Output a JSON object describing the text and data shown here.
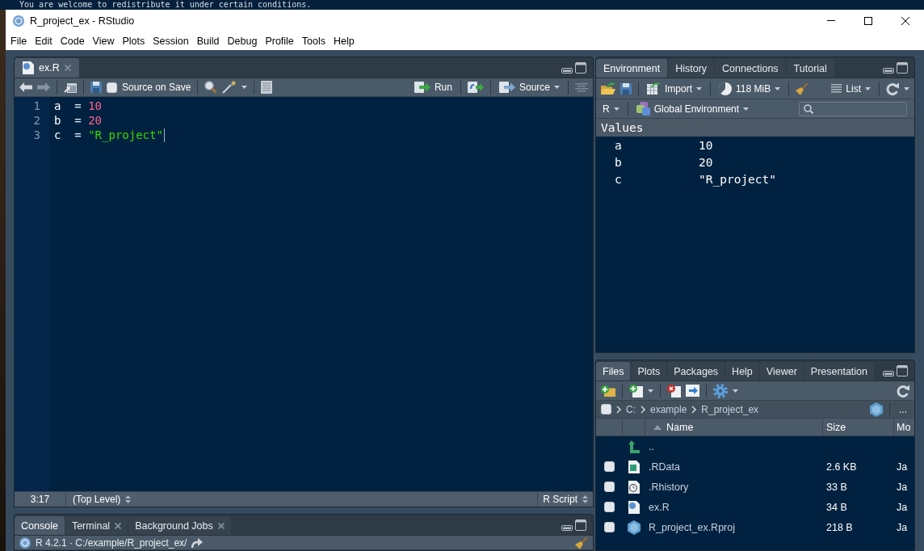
{
  "background_console_text": "You are welcome to redistribute it under certain conditions.",
  "window": {
    "title": "R_project_ex - RStudio"
  },
  "menu": [
    "File",
    "Edit",
    "Code",
    "View",
    "Plots",
    "Session",
    "Build",
    "Debug",
    "Profile",
    "Tools",
    "Help"
  ],
  "editor": {
    "tabs": [
      {
        "label": "ex.R",
        "selected": true,
        "closable": true
      }
    ],
    "toolbar": {
      "source_on_save": {
        "label": "Source on Save",
        "checked": false
      },
      "run": "Run",
      "source": "Source"
    },
    "lines": [
      {
        "number": "1",
        "cursor": false,
        "tokens": [
          {
            "kind": "identifier",
            "text": "a"
          },
          {
            "kind": "operator",
            "text": "  ="
          },
          {
            "kind": "number",
            "text": " 10"
          }
        ]
      },
      {
        "number": "2",
        "cursor": false,
        "tokens": [
          {
            "kind": "identifier",
            "text": "b"
          },
          {
            "kind": "operator",
            "text": "  ="
          },
          {
            "kind": "number",
            "text": " 20"
          }
        ]
      },
      {
        "number": "3",
        "cursor": true,
        "tokens": [
          {
            "kind": "identifier",
            "text": "c"
          },
          {
            "kind": "operator",
            "text": "  ="
          },
          {
            "kind": "string",
            "text": " \"R_project\""
          }
        ]
      }
    ],
    "status": {
      "position": "3:17",
      "scope": "(Top Level)",
      "file_type": "R Script"
    }
  },
  "console": {
    "tabs": [
      {
        "label": "Console",
        "selected": true,
        "closable": false
      },
      {
        "label": "Terminal",
        "selected": false,
        "closable": true
      },
      {
        "label": "Background Jobs",
        "selected": false,
        "closable": true
      }
    ],
    "path": "R 4.2.1 · C:/example/R_project_ex/"
  },
  "environment": {
    "tabs": [
      {
        "label": "Environment",
        "selected": true
      },
      {
        "label": "History",
        "selected": false
      },
      {
        "label": "Connections",
        "selected": false
      },
      {
        "label": "Tutorial",
        "selected": false
      }
    ],
    "toolbar": {
      "import": "Import",
      "memory": "118 MiB",
      "view": "List"
    },
    "language": "R",
    "scope": "Global Environment",
    "section": "Values",
    "values": [
      {
        "name": "a",
        "value": "10"
      },
      {
        "name": "b",
        "value": "20"
      },
      {
        "name": "c",
        "value": "\"R_project\""
      }
    ]
  },
  "files": {
    "tabs": [
      {
        "label": "Files",
        "selected": true
      },
      {
        "label": "Plots",
        "selected": false
      },
      {
        "label": "Packages",
        "selected": false
      },
      {
        "label": "Help",
        "selected": false
      },
      {
        "label": "Viewer",
        "selected": false
      },
      {
        "label": "Presentation",
        "selected": false
      }
    ],
    "path_checkbox": {
      "checked": false
    },
    "path": [
      "C:",
      "example",
      "R_project_ex"
    ],
    "more": "...",
    "columns": [
      "Name",
      "Size",
      "Mo"
    ],
    "rows": [
      {
        "kind": "parent",
        "name": ".."
      },
      {
        "kind": "rdata",
        "name": ".RData",
        "size": "2.6 KB",
        "column_3": "Ja",
        "checked": false
      },
      {
        "kind": "rhistory",
        "name": ".Rhistory",
        "size": "33 B",
        "column_3": "Ja",
        "checked": false
      },
      {
        "kind": "rscript",
        "name": "ex.R",
        "size": "34 B",
        "column_3": "Ja",
        "checked": false
      },
      {
        "kind": "rproj",
        "name": "R_project_ex.Rproj",
        "size": "218 B",
        "column_3": "Ja",
        "checked": false
      }
    ]
  }
}
